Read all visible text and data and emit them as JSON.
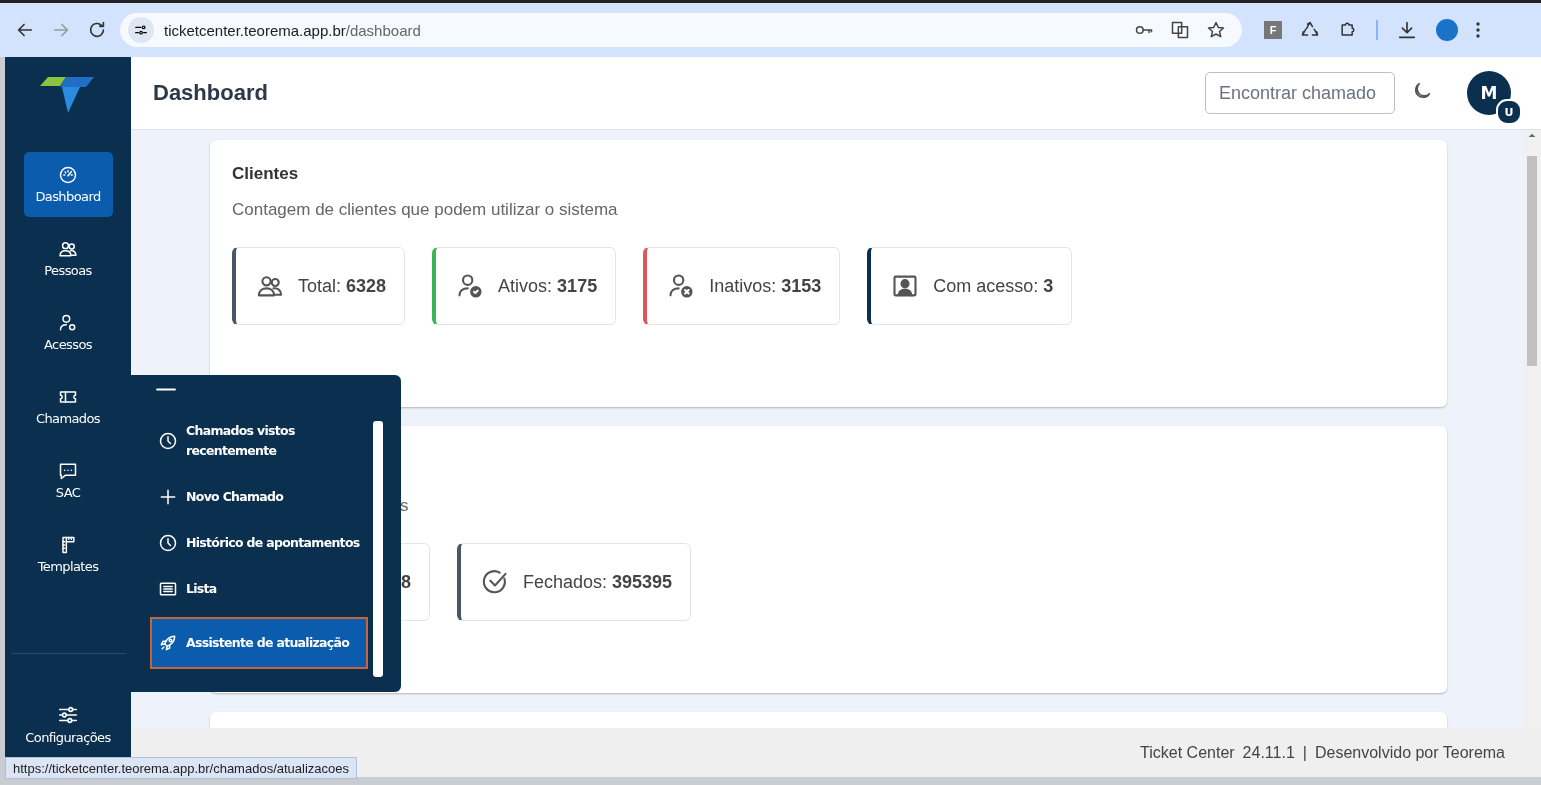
{
  "browser": {
    "url_host": "ticketcenter.teorema.app.br",
    "url_path": "/dashboard",
    "extension_letter": "F"
  },
  "header": {
    "title": "Dashboard",
    "search": {
      "placeholder": "Encontrar chamado"
    },
    "avatar": {
      "initial": "M",
      "badge": "U"
    }
  },
  "sidebar": {
    "items": [
      {
        "label": "Dashboard",
        "selected": true
      },
      {
        "label": "Pessoas",
        "selected": false
      },
      {
        "label": "Acessos",
        "selected": false
      },
      {
        "label": "Chamados",
        "selected": false
      },
      {
        "label": "SAC",
        "selected": false
      },
      {
        "label": "Templates",
        "selected": false
      }
    ],
    "footer_item": {
      "label": "Configurações"
    }
  },
  "submenu": {
    "items": [
      {
        "kind": "partial"
      },
      {
        "kind": "item",
        "label": "Chamados vistos recentemente",
        "selected": false
      },
      {
        "kind": "item",
        "label": "Novo Chamado",
        "selected": false
      },
      {
        "kind": "item",
        "label": "Histórico de apontamentos",
        "selected": false
      },
      {
        "kind": "item",
        "label": "Lista",
        "selected": false
      },
      {
        "kind": "item",
        "label": "Assistente de atualização",
        "selected": true
      }
    ]
  },
  "cards": [
    {
      "kind": "full",
      "title": "Clientes",
      "subtitle": "Contagem de clientes que podem utilizar o sistema",
      "stats": [
        {
          "label": "Total:",
          "value": "6328",
          "color": "#4a5568"
        },
        {
          "label": "Ativos:",
          "value": "3175",
          "color": "#3bb557"
        },
        {
          "label": "Inativos:",
          "value": "3153",
          "color": "#e05656"
        },
        {
          "label": "Com acesso:",
          "value": "3",
          "color": "#0b2f4f"
        }
      ]
    },
    {
      "kind": "covered",
      "subtitle": "s",
      "stats": [
        {
          "value": "8"
        },
        {
          "label": "Fechados:",
          "value": "395395",
          "color": "#4a5568"
        }
      ]
    },
    {
      "kind": "cut"
    }
  ],
  "footer": {
    "app": "Ticket Center",
    "version": "24.11.1",
    "separator": "|",
    "credit": "Desenvolvido por Teorema"
  },
  "status_url": "https://ticketcenter.teorema.app.br/chamados/atualizacoes"
}
